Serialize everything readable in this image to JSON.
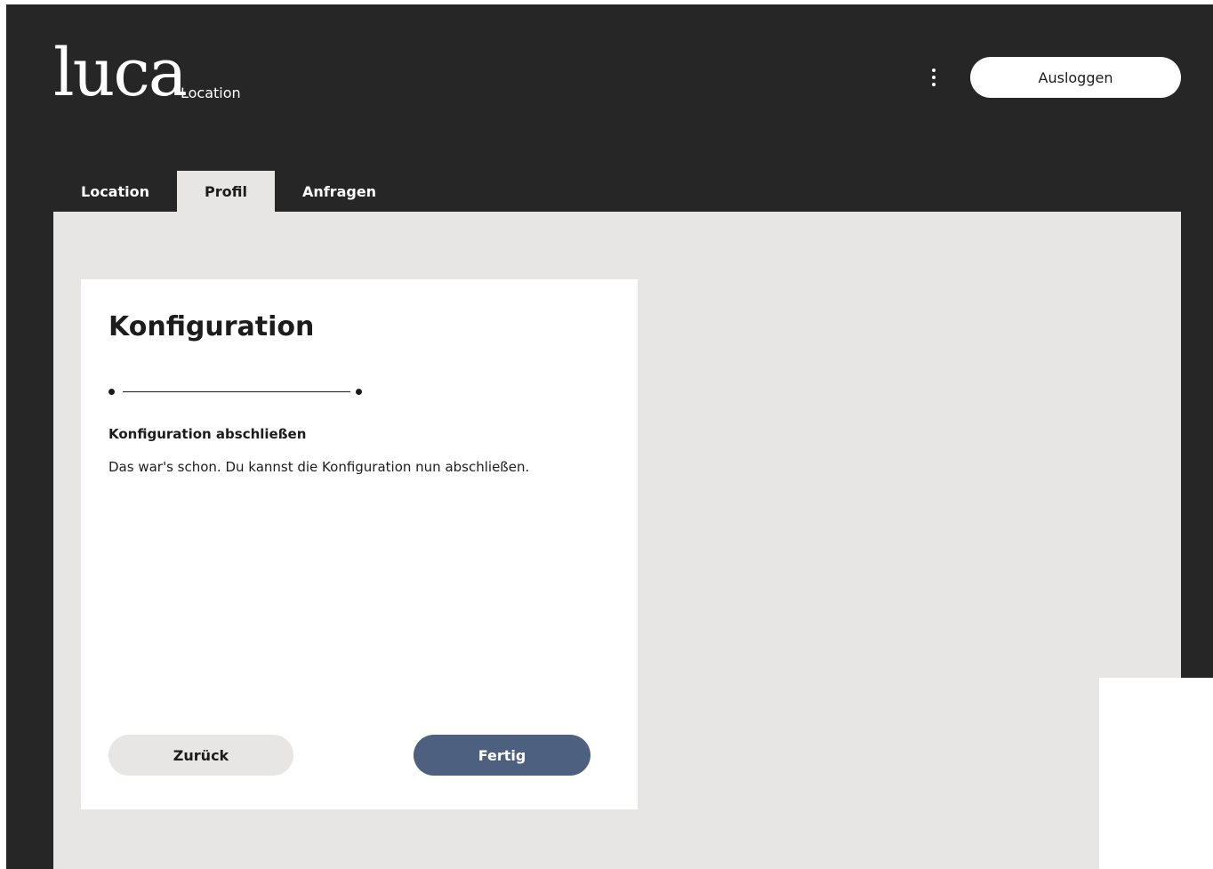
{
  "header": {
    "logo_text": "luca",
    "logo_subtitle": "Location",
    "menu_icon": "vertical-dots-icon",
    "logout_label": "Ausloggen"
  },
  "tabs": [
    {
      "label": "Location",
      "active": false
    },
    {
      "label": "Profil",
      "active": true
    },
    {
      "label": "Anfragen",
      "active": false
    }
  ],
  "card": {
    "title": "Konfiguration",
    "step_heading": "Konfiguration abschließen",
    "step_text": "Das war's schon. Du kannst die Konfiguration nun abschließen.",
    "back_label": "Zurück",
    "done_label": "Fertig"
  },
  "colors": {
    "header_bg": "#262626",
    "content_bg": "#e7e6e4",
    "primary_button": "#4e6080"
  }
}
